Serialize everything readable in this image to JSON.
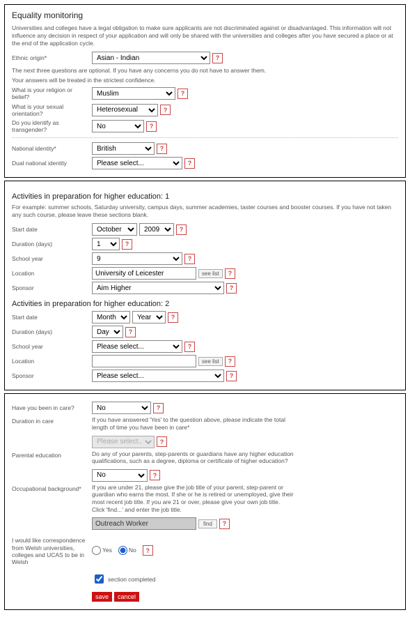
{
  "panel1": {
    "title": "Equality monitoring",
    "intro": "Universities and colleges have a legal obligation to make sure applicants are not discriminated against or disadvantaged. This information will not influence any decision in respect of your application and will only be shared with the universities and colleges after you have secured a place or at the end of the application cycle.",
    "ethnic": {
      "label": "Ethnic origin*",
      "value": "Asian - Indian"
    },
    "note1": "The next three questions are optional. If you have any concerns you do not have to answer them.",
    "note2": "Your answers will be treated in the strictest confidence.",
    "religion": {
      "label": "What is your religion or belief?",
      "value": "Muslim"
    },
    "sexual": {
      "label": "What is your sexual orientation?",
      "value": "Heterosexual"
    },
    "transgender": {
      "label": "Do you identify as transgender?",
      "value": "No"
    },
    "national": {
      "label": "National identity*",
      "value": "British"
    },
    "dual": {
      "label": "Dual national identity",
      "value": "Please select..."
    }
  },
  "panel2": {
    "title1": "Activities in preparation for higher education: 1",
    "intro": "For example: summer schools, Saturday university, campus days, summer academies, taster courses and booster courses. If you have not taken any such course, please leave these sections blank.",
    "a1": {
      "start": {
        "label": "Start date",
        "month": "October",
        "year": "2009"
      },
      "duration": {
        "label": "Duration (days)",
        "value": "1"
      },
      "schoolyear": {
        "label": "School year",
        "value": "9"
      },
      "location": {
        "label": "Location",
        "value": "University of Leicester",
        "seelist": "see list"
      },
      "sponsor": {
        "label": "Sponsor",
        "value": "Aim Higher"
      }
    },
    "title2": "Activities in preparation for higher education: 2",
    "a2": {
      "start": {
        "label": "Start date",
        "month": "Month",
        "year": "Year"
      },
      "duration": {
        "label": "Duration (days)",
        "value": "Day"
      },
      "schoolyear": {
        "label": "School year",
        "value": "Please select..."
      },
      "location": {
        "label": "Location",
        "value": "",
        "seelist": "see list"
      },
      "sponsor": {
        "label": "Sponsor",
        "value": "Please select..."
      }
    }
  },
  "panel3": {
    "care": {
      "label": "Have you been in care?",
      "value": "No"
    },
    "duration_care": {
      "label": "Duration in care",
      "desc": "If you have answered 'Yes' to the question above, please indicate the total length of time you have been in care*",
      "value": "Please select..."
    },
    "parental": {
      "label": "Parental education",
      "desc": "Do any of your parents, step-parents or guardians have any higher education qualifications, such as a degree, diploma or certificate of higher education?",
      "value": "No"
    },
    "occupational": {
      "label": "Occupational background*",
      "desc": "If you are under 21, please give the job title of your parent, step-parent or guardian who earns the most. If she or he is retired or unemployed, give their most recent job title. If you are 21 or over, please give your own job title. Click 'find...' and enter the job title.",
      "value": "Outreach Worker",
      "find": "find"
    },
    "welsh": {
      "label": "I would like correspondence from Welsh universities, colleges and UCAS to be in Welsh",
      "yes": "Yes",
      "no": "No"
    },
    "section_completed": "section completed",
    "save": "save",
    "cancel": "cancel"
  },
  "help": "?"
}
